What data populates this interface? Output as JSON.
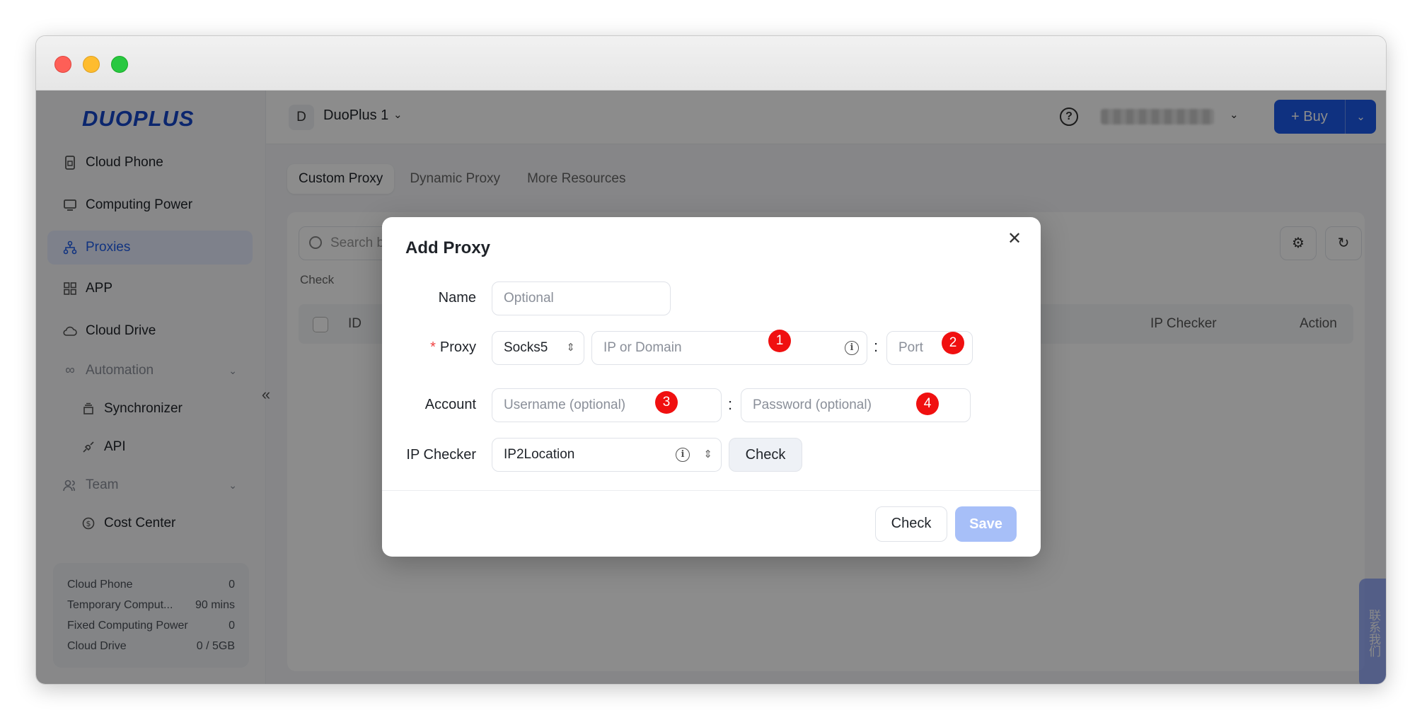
{
  "sidebar": {
    "logo": "DUOPLUS",
    "items": [
      {
        "label": "Cloud Phone",
        "icon": "phone-icon"
      },
      {
        "label": "Computing Power",
        "icon": "monitor-icon"
      },
      {
        "label": "Proxies",
        "icon": "network-icon"
      },
      {
        "label": "APP",
        "icon": "grid-icon"
      },
      {
        "label": "Cloud Drive",
        "icon": "cloud-icon"
      }
    ],
    "automation": {
      "label": "Automation",
      "children": [
        "Synchronizer",
        "API"
      ]
    },
    "team": {
      "label": "Team",
      "children": [
        "Cost Center"
      ]
    },
    "quota": [
      {
        "label": "Cloud Phone",
        "value": "0"
      },
      {
        "label": "Temporary Comput...",
        "value": "90 mins"
      },
      {
        "label": "Fixed Computing Power",
        "value": "0"
      },
      {
        "label": "Cloud Drive",
        "value": "0 / 5GB"
      }
    ]
  },
  "topbar": {
    "workspace_initial": "D",
    "workspace_name": "DuoPlus 1",
    "buy_label": "+ Buy"
  },
  "content": {
    "tabs": [
      "Custom Proxy",
      "Dynamic Proxy",
      "More Resources"
    ],
    "search_placeholder": "Search b",
    "check_label": "Check",
    "table_headers": [
      "ID",
      "IP Checker",
      "Action"
    ]
  },
  "side_float": "联系我们",
  "modal": {
    "title": "Add Proxy",
    "name_label": "Name",
    "name_placeholder": "Optional",
    "proxy_label": "Proxy",
    "proxy_type": "Socks5",
    "host_placeholder": "IP or Domain",
    "port_placeholder": "Port",
    "account_label": "Account",
    "username_placeholder": "Username (optional)",
    "password_placeholder": "Password (optional)",
    "checker_label": "IP Checker",
    "checker_value": "IP2Location",
    "check_inline": "Check",
    "check_button": "Check",
    "save_button": "Save",
    "colon": ":",
    "badges": [
      "1",
      "2",
      "3",
      "4"
    ]
  }
}
